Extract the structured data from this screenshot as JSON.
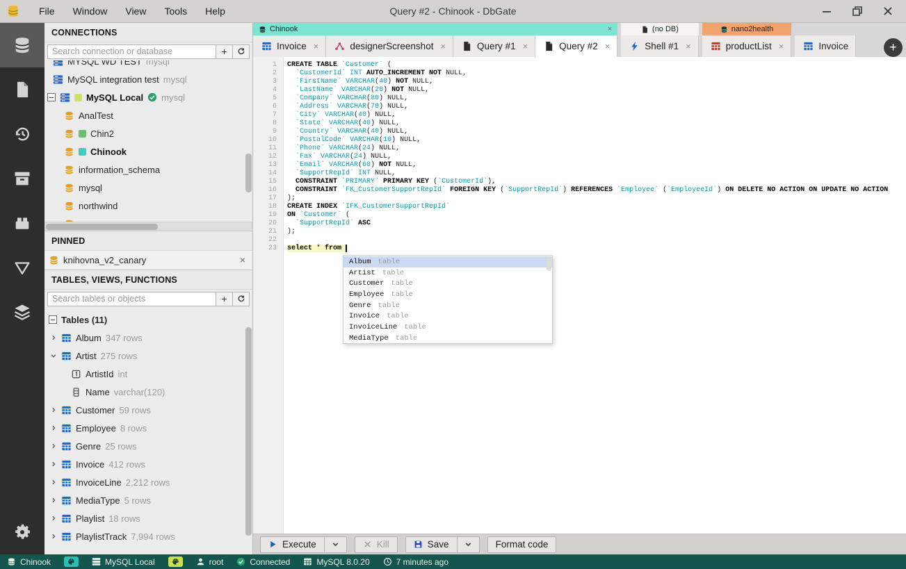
{
  "titlebar": {
    "title": "Query #2 - Chinook - DbGate",
    "menus": [
      "File",
      "Window",
      "View",
      "Tools",
      "Help"
    ]
  },
  "sidebar_rail": {
    "items": [
      {
        "icon": "database",
        "active": true
      },
      {
        "icon": "file",
        "active": false
      },
      {
        "icon": "history",
        "active": false
      },
      {
        "icon": "archive",
        "active": false
      },
      {
        "icon": "plugins",
        "active": false
      },
      {
        "icon": "query-designer",
        "active": false
      },
      {
        "icon": "layers",
        "active": false
      }
    ],
    "bottom_items": [
      {
        "icon": "settings",
        "active": false
      }
    ]
  },
  "connections": {
    "header": "CONNECTIONS",
    "search_placeholder": "Search connection or database",
    "items": [
      {
        "label": "MYSQL WD TEST",
        "engine": "mysql",
        "clipped_top": true
      },
      {
        "label": "MySQL integration test",
        "engine": "mysql"
      },
      {
        "label": "MySQL Local",
        "engine": "mysql",
        "bold": true,
        "expanded": true,
        "chip": "#cde26a",
        "connected": true
      }
    ],
    "databases": [
      {
        "label": "AnalTest"
      },
      {
        "label": "Chin2",
        "chip": "#6ec06e"
      },
      {
        "label": "Chinook",
        "chip": "#3ecfbf",
        "bold": true
      },
      {
        "label": "information_schema"
      },
      {
        "label": "mysql"
      },
      {
        "label": "northwind"
      },
      {
        "label": "",
        "clipped_bottom": true
      }
    ]
  },
  "pinned": {
    "header": "PINNED",
    "items": [
      {
        "label": "knihovna_v2_canary"
      }
    ]
  },
  "tables_panel": {
    "header": "TABLES, VIEWS, FUNCTIONS",
    "search_placeholder": "Search tables or objects",
    "root_label": "Tables (11)",
    "tables": [
      {
        "name": "Album",
        "rows": "347 rows"
      },
      {
        "name": "Artist",
        "rows": "275 rows",
        "expanded": true,
        "columns": [
          {
            "name": "ArtistId",
            "type": "int",
            "icon": "pk-column"
          },
          {
            "name": "Name",
            "type": "varchar(120)",
            "icon": "column"
          }
        ]
      },
      {
        "name": "Customer",
        "rows": "59 rows"
      },
      {
        "name": "Employee",
        "rows": "8 rows"
      },
      {
        "name": "Genre",
        "rows": "25 rows"
      },
      {
        "name": "Invoice",
        "rows": "412 rows"
      },
      {
        "name": "InvoiceLine",
        "rows": "2,212 rows"
      },
      {
        "name": "MediaType",
        "rows": "5 rows"
      },
      {
        "name": "Playlist",
        "rows": "18 rows"
      },
      {
        "name": "PlaylistTrack",
        "rows": "7,994 rows"
      }
    ]
  },
  "tab_groups": [
    {
      "label": "Chinook",
      "color": "#7de3d3",
      "icon": "db-dark",
      "closable": true,
      "tabs": [
        {
          "label": "Invoice",
          "icon": "table-blue"
        },
        {
          "label": "designerScreenshot",
          "icon": "designer"
        },
        {
          "label": "Query #1",
          "icon": "file-dark"
        },
        {
          "label": "Query #2",
          "icon": "file-dark",
          "active": true
        }
      ]
    },
    {
      "label": "(no DB)",
      "color": "#f4f3f1",
      "icon": "file-dark",
      "tabs": [
        {
          "label": "Shell #1",
          "icon": "bolt"
        }
      ]
    },
    {
      "label": "nano2health",
      "color": "#f3a36e",
      "icon": "db-dark",
      "tabs": [
        {
          "label": "productList",
          "icon": "table-red"
        }
      ]
    },
    {
      "label": "",
      "color": "transparent",
      "tabs": [
        {
          "label": "Invoice",
          "icon": "table-blue",
          "clipped": true
        }
      ]
    }
  ],
  "new_tab_label": "+",
  "editor": {
    "lines": [
      {
        "n": 1,
        "seg": [
          [
            "k",
            "CREATE TABLE"
          ],
          [
            "t",
            " `Customer`"
          ],
          [
            "p",
            " ("
          ]
        ]
      },
      {
        "n": 2,
        "seg": [
          [
            "p",
            "  "
          ],
          [
            "t",
            "`CustomerId` INT"
          ],
          [
            "k",
            " AUTO_INCREMENT NOT"
          ],
          [
            "p",
            " NULL,"
          ]
        ]
      },
      {
        "n": 3,
        "seg": [
          [
            "p",
            "  "
          ],
          [
            "t",
            "`FirstName` VARCHAR"
          ],
          [
            "p",
            "("
          ],
          [
            "t",
            "40"
          ],
          [
            "p",
            ")"
          ],
          [
            "k",
            " NOT"
          ],
          [
            "p",
            " NULL,"
          ]
        ]
      },
      {
        "n": 4,
        "seg": [
          [
            "p",
            "  "
          ],
          [
            "t",
            "`LastName` VARCHAR"
          ],
          [
            "p",
            "("
          ],
          [
            "t",
            "20"
          ],
          [
            "p",
            ")"
          ],
          [
            "k",
            " NOT"
          ],
          [
            "p",
            " NULL,"
          ]
        ]
      },
      {
        "n": 5,
        "seg": [
          [
            "p",
            "  "
          ],
          [
            "t",
            "`Company` VARCHAR"
          ],
          [
            "p",
            "("
          ],
          [
            "t",
            "80"
          ],
          [
            "p",
            ")"
          ],
          [
            "p",
            " NULL,"
          ]
        ]
      },
      {
        "n": 6,
        "seg": [
          [
            "p",
            "  "
          ],
          [
            "t",
            "`Address` VARCHAR"
          ],
          [
            "p",
            "("
          ],
          [
            "t",
            "70"
          ],
          [
            "p",
            ")"
          ],
          [
            "p",
            " NULL,"
          ]
        ]
      },
      {
        "n": 7,
        "seg": [
          [
            "p",
            "  "
          ],
          [
            "t",
            "`City` VARCHAR"
          ],
          [
            "p",
            "("
          ],
          [
            "t",
            "40"
          ],
          [
            "p",
            ")"
          ],
          [
            "p",
            " NULL,"
          ]
        ]
      },
      {
        "n": 8,
        "seg": [
          [
            "p",
            "  "
          ],
          [
            "t",
            "`State` VARCHAR"
          ],
          [
            "p",
            "("
          ],
          [
            "t",
            "40"
          ],
          [
            "p",
            ")"
          ],
          [
            "p",
            " NULL,"
          ]
        ]
      },
      {
        "n": 9,
        "seg": [
          [
            "p",
            "  "
          ],
          [
            "t",
            "`Country` VARCHAR"
          ],
          [
            "p",
            "("
          ],
          [
            "t",
            "40"
          ],
          [
            "p",
            ")"
          ],
          [
            "p",
            " NULL,"
          ]
        ]
      },
      {
        "n": 10,
        "seg": [
          [
            "p",
            "  "
          ],
          [
            "t",
            "`PostalCode` VARCHAR"
          ],
          [
            "p",
            "("
          ],
          [
            "t",
            "10"
          ],
          [
            "p",
            ")"
          ],
          [
            "p",
            " NULL,"
          ]
        ]
      },
      {
        "n": 11,
        "seg": [
          [
            "p",
            "  "
          ],
          [
            "t",
            "`Phone` VARCHAR"
          ],
          [
            "p",
            "("
          ],
          [
            "t",
            "24"
          ],
          [
            "p",
            ")"
          ],
          [
            "p",
            " NULL,"
          ]
        ]
      },
      {
        "n": 12,
        "seg": [
          [
            "p",
            "  "
          ],
          [
            "t",
            "`Fax` VARCHAR"
          ],
          [
            "p",
            "("
          ],
          [
            "t",
            "24"
          ],
          [
            "p",
            ")"
          ],
          [
            "p",
            " NULL,"
          ]
        ]
      },
      {
        "n": 13,
        "seg": [
          [
            "p",
            "  "
          ],
          [
            "t",
            "`Email` VARCHAR"
          ],
          [
            "p",
            "("
          ],
          [
            "t",
            "60"
          ],
          [
            "p",
            ")"
          ],
          [
            "k",
            " NOT"
          ],
          [
            "p",
            " NULL,"
          ]
        ]
      },
      {
        "n": 14,
        "seg": [
          [
            "p",
            "  "
          ],
          [
            "t",
            "`SupportRepId` INT"
          ],
          [
            "p",
            " NULL,"
          ]
        ]
      },
      {
        "n": 15,
        "seg": [
          [
            "p",
            "  "
          ],
          [
            "k",
            "CONSTRAINT"
          ],
          [
            "t",
            " `PRIMARY`"
          ],
          [
            "k",
            " PRIMARY KEY"
          ],
          [
            "p",
            " ("
          ],
          [
            "t",
            "`CustomerId`"
          ],
          [
            "p",
            "),"
          ]
        ]
      },
      {
        "n": 16,
        "seg": [
          [
            "p",
            "  "
          ],
          [
            "k",
            "CONSTRAINT"
          ],
          [
            "t",
            " `FK_CustomerSupportRepId`"
          ],
          [
            "k",
            " FOREIGN KEY"
          ],
          [
            "p",
            " ("
          ],
          [
            "t",
            "`SupportRepId`"
          ],
          [
            "p",
            ")"
          ],
          [
            "k",
            " REFERENCES"
          ],
          [
            "t",
            " `Employee`"
          ],
          [
            "p",
            " ("
          ],
          [
            "t",
            "`EmployeeId`"
          ],
          [
            "p",
            ")"
          ],
          [
            "k",
            " ON DELETE NO ACTION ON UPDATE NO ACTION"
          ]
        ]
      },
      {
        "n": 17,
        "seg": [
          [
            "p",
            ");"
          ]
        ]
      },
      {
        "n": 18,
        "seg": [
          [
            "k",
            "CREATE INDEX"
          ],
          [
            "t",
            " `IFK_CustomerSupportRepId`"
          ]
        ]
      },
      {
        "n": 19,
        "seg": [
          [
            "k",
            "ON"
          ],
          [
            "t",
            " `Customer`"
          ],
          [
            "p",
            " ("
          ]
        ]
      },
      {
        "n": 20,
        "seg": [
          [
            "p",
            "  "
          ],
          [
            "t",
            "`SupportRepId`"
          ],
          [
            "k",
            " ASC"
          ]
        ]
      },
      {
        "n": 21,
        "seg": [
          [
            "p",
            ");"
          ]
        ]
      },
      {
        "n": 22,
        "seg": []
      },
      {
        "n": 23,
        "seg": [
          [
            "k",
            "select"
          ],
          [
            "p",
            " * "
          ],
          [
            "k",
            "from"
          ],
          [
            "p",
            " "
          ]
        ],
        "highlight": true,
        "cursor": true
      }
    ]
  },
  "autocomplete": {
    "items": [
      {
        "name": "Album",
        "kind": "table",
        "selected": true
      },
      {
        "name": "Artist",
        "kind": "table"
      },
      {
        "name": "Customer",
        "kind": "table"
      },
      {
        "name": "Employee",
        "kind": "table"
      },
      {
        "name": "Genre",
        "kind": "table"
      },
      {
        "name": "Invoice",
        "kind": "table"
      },
      {
        "name": "InvoiceLine",
        "kind": "table"
      },
      {
        "name": "MediaType",
        "kind": "table"
      }
    ]
  },
  "toolbar": {
    "execute": "Execute",
    "kill": "Kill",
    "save": "Save",
    "format_code": "Format code"
  },
  "statusbar": {
    "items": [
      {
        "icon": "db-white",
        "label": "Chinook"
      },
      {
        "icon": "palette",
        "chip": "#2fbdb3",
        "label": ""
      },
      {
        "icon": "server-white",
        "label": "MySQL Local"
      },
      {
        "icon": "palette",
        "chip": "#cede51",
        "label": ""
      },
      {
        "icon": "user",
        "label": "root"
      },
      {
        "icon": "check-circle",
        "label": "Connected"
      },
      {
        "icon": "grid-white",
        "label": "MySQL 8.0.20"
      },
      {
        "icon": "clock",
        "label": "7 minutes ago"
      }
    ]
  },
  "colors": {
    "group_teal": "#7de3d3",
    "group_orange": "#f3a36e",
    "statusbar_bg": "#14564e",
    "selection_blue": "#ccd9f4",
    "statement_highlight": "#f8f7c9",
    "identifier_teal": "#0e9aa8",
    "accent_blue": "#1c66d6",
    "rail_bg": "#2d2d2d"
  }
}
